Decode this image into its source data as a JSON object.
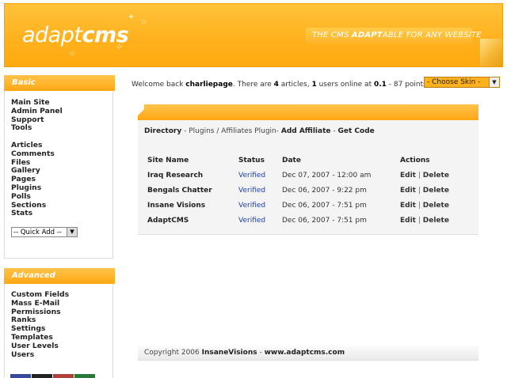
{
  "header": {
    "logo_light": "adapt",
    "logo_bold": "cms",
    "tagline_pre": "THE CMS ",
    "tagline_bold": "ADAPT",
    "tagline_post": "ABLE FOR ANY WEBSITE"
  },
  "sidebar_basic": {
    "title": "Basic",
    "group1": [
      "Main Site",
      "Admin Panel",
      "Support",
      "Tools"
    ],
    "group2": [
      "Articles",
      "Comments",
      "Files",
      "Gallery",
      "Pages",
      "Plugins",
      "Polls",
      "Sections",
      "Stats"
    ],
    "quick_add": "-- Quick Add --"
  },
  "sidebar_advanced": {
    "title": "Advanced",
    "items": [
      "Custom Fields",
      "Mass E-Mail",
      "Permissions",
      "Ranks",
      "Settings",
      "Templates",
      "User Levels",
      "Users"
    ]
  },
  "welcome": {
    "pre": "Welcome back ",
    "user": "charliepage",
    "mid1": ". There are ",
    "articles": "4",
    "mid2": " articles, ",
    "users": "1",
    "mid3": " users online at ",
    "score": "0.1",
    "post": " - 87 points"
  },
  "skin_select": "- Choose Skin -",
  "breadcrumb": {
    "directory": "Directory",
    "sep1": " - ",
    "plugins": "Plugins / Affiliates Plugin",
    "sep2": "- ",
    "add": "Add Affiliate",
    "sep3": " - ",
    "code": "Get Code"
  },
  "table": {
    "headers": [
      "Site Name",
      "Status",
      "Date",
      "Actions"
    ],
    "rows": [
      {
        "site": "Iraq Research",
        "status": "Verified",
        "date": "Dec 07, 2007 - 12:00 am",
        "edit": "Edit",
        "delete": "Delete"
      },
      {
        "site": "Bengals Chatter",
        "status": "Verified",
        "date": "Dec 06, 2007 - 9:22 pm",
        "edit": "Edit",
        "delete": "Delete"
      },
      {
        "site": "Insane Visions",
        "status": "Verified",
        "date": "Dec 06, 2007 - 7:51 pm",
        "edit": "Edit",
        "delete": "Delete"
      },
      {
        "site": "AdaptCMS",
        "status": "Verified",
        "date": "Dec 06, 2007 - 7:51 pm",
        "edit": "Edit",
        "delete": "Delete"
      }
    ],
    "action_sep": " | "
  },
  "footer": {
    "pre": "Copyright 2006 ",
    "company": "InsaneVisions",
    "sep": " - ",
    "site": "www.adaptcms.com"
  },
  "colors": {
    "accent": "#ffa812",
    "link_blue": "#1a3fbf"
  }
}
